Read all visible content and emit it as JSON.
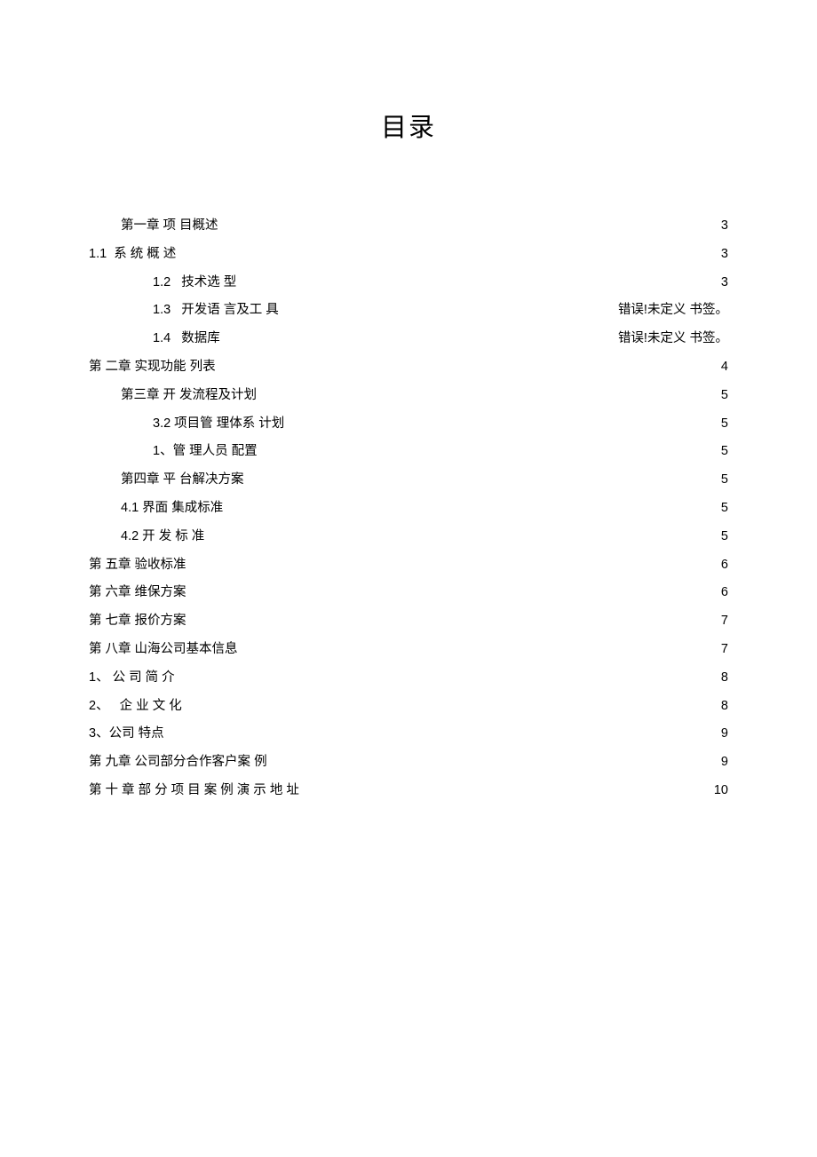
{
  "title": "目录",
  "toc": [
    {
      "label": "第一章 项 目概述",
      "page": "3",
      "indent": 1
    },
    {
      "label": "1.1  系 统 概 述",
      "page": "3",
      "indent": 0
    },
    {
      "label": "1.2   技术选 型",
      "page": "3",
      "indent": 2
    },
    {
      "label": "1.3   开发语 言及工 具",
      "page": "错误!未定义 书签。",
      "indent": 2
    },
    {
      "label": "1.4   数据库",
      "page": "错误!未定义 书签。",
      "indent": 2
    },
    {
      "label": "第 二章 实现功能 列表",
      "page": "4",
      "indent": 0
    },
    {
      "label": "第三章 开 发流程及计划",
      "page": "5",
      "indent": 1
    },
    {
      "label": "3.2 项目管 理体系 计划",
      "page": "5",
      "indent": 2
    },
    {
      "label": "1、管 理人员 配置",
      "page": "5",
      "indent": 2
    },
    {
      "label": "第四章 平 台解决方案",
      "page": "5",
      "indent": 1
    },
    {
      "label": "4.1 界面 集成标准",
      "page": "5",
      "indent": 1
    },
    {
      "label": "4.2 开 发 标 准",
      "page": "5",
      "indent": 1
    },
    {
      "label": "第 五章 验收标准",
      "page": "6",
      "indent": 0
    },
    {
      "label": "第 六章 维保方案",
      "page": "6",
      "indent": 0
    },
    {
      "label": "第 七章 报价方案",
      "page": "7",
      "indent": 0
    },
    {
      "label": "第 八章 山海公司基本信息",
      "page": "7",
      "indent": 0
    },
    {
      "label": "1、 公 司 简 介",
      "page": "8",
      "indent": 0
    },
    {
      "label": "2、   企 业 文 化",
      "page": "8",
      "indent": 0
    },
    {
      "label": "3、公司 特点",
      "page": "9",
      "indent": 0
    },
    {
      "label": "第 九章 公司部分合作客户案 例",
      "page": "9",
      "indent": 0
    },
    {
      "label": "第 十 章 部 分 项 目 案 例 演 示 地 址",
      "page": "10",
      "indent": 0
    }
  ]
}
